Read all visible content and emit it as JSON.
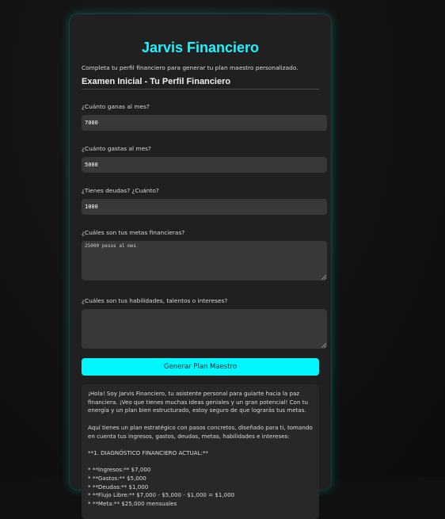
{
  "app": {
    "title": "Jarvis Financiero",
    "intro": "Completa tu perfil financiero para generar tu plan maestro personalizado."
  },
  "form": {
    "section_title": "Examen Inicial - Tu Perfil Financiero",
    "fields": [
      {
        "label": "¿Cuánto ganas al mes?",
        "value": "7000"
      },
      {
        "label": "¿Cuánto gastas al mes?",
        "value": "5000"
      },
      {
        "label": "¿Tienes deudas? ¿Cuánto?",
        "value": "1000"
      },
      {
        "label": "¿Cuáles son tus metas financieras?",
        "value": "25000 pesos al mes"
      },
      {
        "label": "¿Cuáles son tus habilidades, talentos o intereses?",
        "value": ""
      }
    ],
    "submit_label": "Generar Plan Maestro"
  },
  "response": {
    "para1": "¡Hola! Soy Jarvis Financiero, tu asistente personal para guiarte hacia la paz financiera. ¡Veo que tienes muchas ideas geniales y un gran potencial! Con tu energía y un plan bien estructurado, estoy seguro de que lograrás tus metas.",
    "para2": "Aquí tienes un plan estratégico con pasos concretos, diseñado para ti, tomando en cuenta tus ingresos, gastos, deudas, metas, habilidades e intereses:",
    "heading": "**1. DIAGNÓSTICO FINANCIERO ACTUAL:**",
    "bullets": [
      "* **Ingresos:** $7,000",
      "* **Gastos:** $5,000",
      "* **Deudas:** $1,000",
      "* **Flujo Libre:** $7,000 - $5,000 - $1,000 = $1,000",
      "* **Meta:** $25,000 mensuales"
    ]
  }
}
